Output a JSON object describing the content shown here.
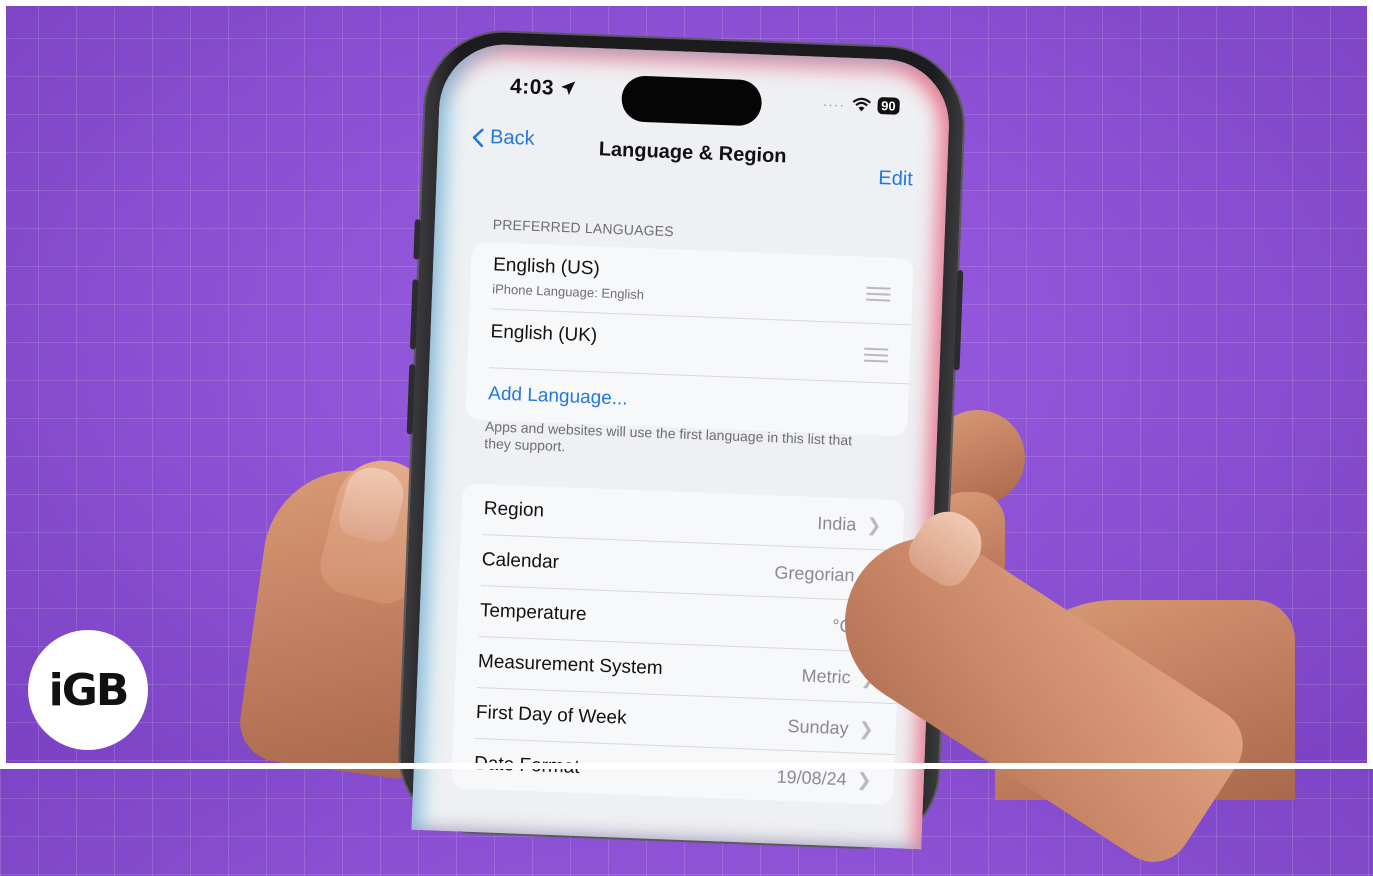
{
  "status_bar": {
    "time": "4:03",
    "signal": "····",
    "battery": "90"
  },
  "nav": {
    "back_label": "Back",
    "title": "Language & Region",
    "edit_label": "Edit"
  },
  "preferred_languages": {
    "header": "PREFERRED LANGUAGES",
    "items": [
      {
        "name": "English (US)",
        "subtitle": "iPhone Language: English"
      },
      {
        "name": "English (UK)",
        "subtitle": ""
      }
    ],
    "add_label": "Add Language...",
    "footer": "Apps and websites will use the first language in this list that they support."
  },
  "settings": [
    {
      "label": "Region",
      "value": "India"
    },
    {
      "label": "Calendar",
      "value": "Gregorian"
    },
    {
      "label": "Temperature",
      "value": "°C"
    },
    {
      "label": "Measurement System",
      "value": "Metric"
    },
    {
      "label": "First Day of Week",
      "value": "Sunday"
    },
    {
      "label": "Date Format",
      "value": "19/08/24"
    }
  ],
  "logo": {
    "text": "iGB"
  },
  "colors": {
    "background": "#8e52d6",
    "accent": "#2477e0"
  },
  "icons": {
    "back": "chevron-left-icon",
    "location": "location-arrow-icon",
    "wifi": "wifi-icon",
    "drag": "reorder-icon",
    "disclosure": "chevron-right-icon"
  }
}
